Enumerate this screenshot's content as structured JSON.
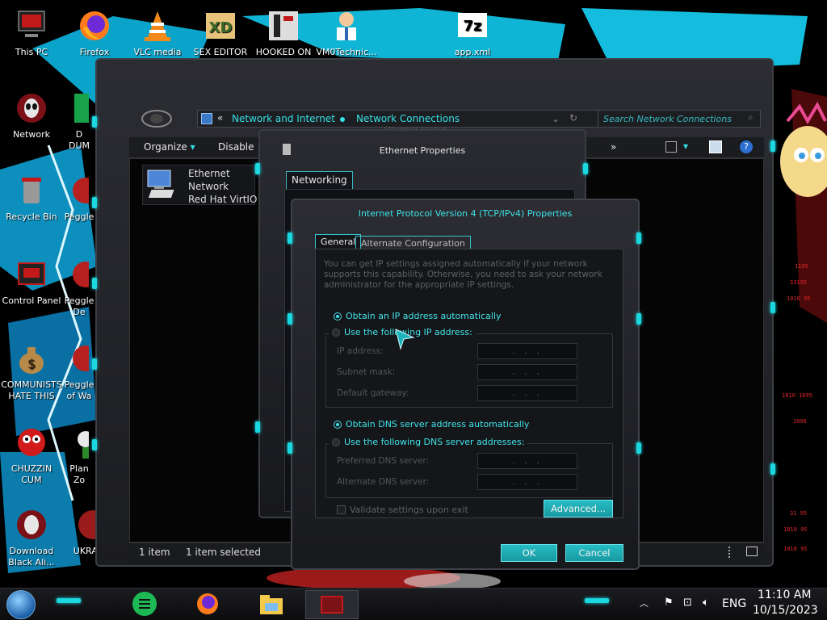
{
  "colors": {
    "accent": "#35e1e6",
    "frame": "#2c2d33",
    "button": "#1fb0b8",
    "red": "#e2262a"
  },
  "desktop": {
    "icons": [
      {
        "label": "This PC"
      },
      {
        "label": "Firefox"
      },
      {
        "label": "VLC media"
      },
      {
        "label": "SEX EDITOR"
      },
      {
        "label": "HOOKED ON"
      },
      {
        "label": "VM0Technic..."
      },
      {
        "label": "app.xml"
      },
      {
        "label": "Network"
      },
      {
        "label": "Recycle Bin"
      },
      {
        "label": "Control Panel"
      },
      {
        "label": "COMMUNISTS HATE THIS G..."
      },
      {
        "label": "CHUZZIN CUM"
      },
      {
        "label": "Download Black Ali..."
      },
      {
        "label": "UKRAINE"
      }
    ],
    "partial": [
      "D",
      "DUM",
      "Peggle",
      "Peggle",
      "De",
      "Peggle",
      "of Wa",
      "Plan",
      "Zo"
    ]
  },
  "explorer": {
    "breadcrumb": [
      "Network and Internet",
      "Network Connections"
    ],
    "search_placeholder": "Search Network Connections",
    "toolbar": {
      "organize": "Organize",
      "disable": "Disable",
      "more": "»"
    },
    "item": {
      "line1": "Ethernet",
      "line2": "Network",
      "line3": "Red Hat VirtIO E"
    },
    "status": {
      "count": "1 item",
      "selected": "1 item selected"
    },
    "ghost_title": "Ethernet Status"
  },
  "eth_props": {
    "title": "Ethernet Properties",
    "tab": "Networking"
  },
  "ipv4": {
    "title": "Internet Protocol Version 4 (TCP/IPv4) Properties",
    "tabs": [
      "General",
      "Alternate Configuration"
    ],
    "description": "You can get IP settings assigned automatically if your network supports this capability. Otherwise, you need to ask your network administrator for the appropriate IP settings.",
    "radio_auto_ip": "Obtain an IP address automatically",
    "radio_manual_ip": "Use the following IP address:",
    "ip_label": "IP address:",
    "subnet_label": "Subnet mask:",
    "gateway_label": "Default gateway:",
    "radio_auto_dns": "Obtain DNS server address automatically",
    "radio_manual_dns": "Use the following DNS server addresses:",
    "pref_dns_label": "Preferred DNS server:",
    "alt_dns_label": "Alternate DNS server:",
    "ip_placeholder": ". . .",
    "validate": "Validate settings upon exit",
    "advanced": "Advanced...",
    "ok": "OK",
    "cancel": "Cancel"
  },
  "taskbar": {
    "lang": "ENG",
    "time": "11:10 AM",
    "date": "10/15/2023"
  }
}
